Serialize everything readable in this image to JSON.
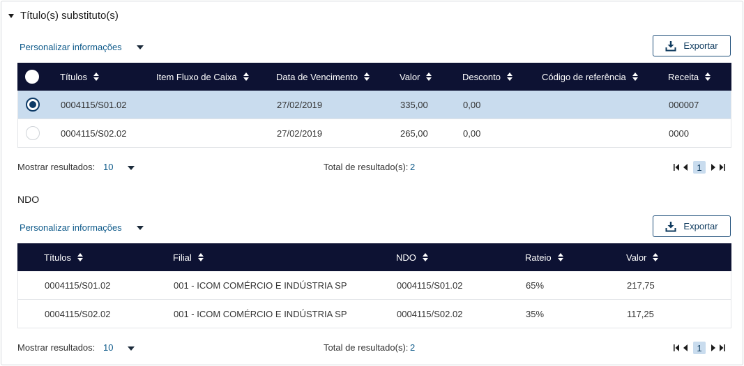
{
  "section": {
    "title": "Título(s) substituto(s)"
  },
  "table1": {
    "customize_label": "Personalizar informações",
    "export_label": "Exportar",
    "columns": [
      "Títulos",
      "Item Fluxo de Caixa",
      "Data de Vencimento",
      "Valor",
      "Desconto",
      "Código de referência",
      "Receita"
    ],
    "rows": [
      {
        "selected": true,
        "titulo": "0004115/S01.02",
        "item": "",
        "vencimento": "27/02/2019",
        "valor": "335,00",
        "desconto": "0,00",
        "codigo": "",
        "receita": "000007"
      },
      {
        "selected": false,
        "titulo": "0004115/S02.02",
        "item": "",
        "vencimento": "27/02/2019",
        "valor": "265,00",
        "desconto": "0,00",
        "codigo": "",
        "receita": "0000"
      }
    ],
    "footer": {
      "show_label": "Mostrar resultados:",
      "show_value": "10",
      "total_label": "Total de resultado(s):",
      "total_value": "2",
      "page": "1"
    }
  },
  "ndo": {
    "title": "NDO",
    "customize_label": "Personalizar informações",
    "export_label": "Exportar",
    "columns": [
      "Títulos",
      "Filial",
      "NDO",
      "Rateio",
      "Valor"
    ],
    "rows": [
      {
        "titulo": "0004115/S01.02",
        "filial": "001 - ICOM COMÉRCIO E INDÚSTRIA SP",
        "ndo": "0004115/S01.02",
        "rateio": "65%",
        "valor": "217,75"
      },
      {
        "titulo": "0004115/S02.02",
        "filial": "001 - ICOM COMÉRCIO E INDÚSTRIA SP",
        "ndo": "0004115/S02.02",
        "rateio": "35%",
        "valor": "117,25"
      }
    ],
    "footer": {
      "show_label": "Mostrar resultados:",
      "show_value": "10",
      "total_label": "Total de resultado(s):",
      "total_value": "2",
      "page": "1"
    }
  },
  "colors": {
    "header_bg": "#0d1233",
    "accent": "#0e5a8a",
    "selected_row": "#c9dcee",
    "button_border": "#1f4f7a"
  },
  "icons": {
    "collapse": "caret-down-icon",
    "export": "download-icon",
    "sort": "sort-icon",
    "pager": [
      "first-page-icon",
      "prev-page-icon",
      "next-page-icon",
      "last-page-icon"
    ]
  }
}
